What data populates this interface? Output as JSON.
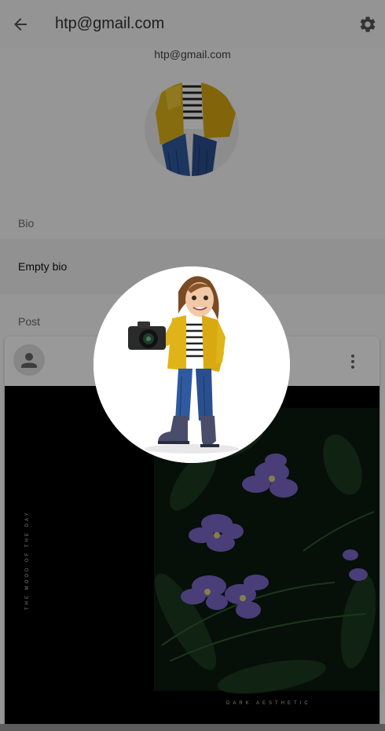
{
  "appbar": {
    "title": "htp@gmail.com",
    "back_icon": "arrow-back-icon",
    "settings_icon": "gear-icon"
  },
  "profile": {
    "email": "htp@gmail.com",
    "avatar": "cartoon-photographer-avatar"
  },
  "bio": {
    "label": "Bio",
    "text": "Empty bio"
  },
  "posts": {
    "label": "Post",
    "card": {
      "author_icon": "person-icon",
      "menu_icon": "more-vert-icon",
      "image_side_text": "THE MOOD OF THE DAY",
      "image_bottom_text": "DARK AESTHETIC"
    }
  },
  "overlay": {
    "avatar": "cartoon-photographer-avatar-enlarged",
    "scrim_opacity": 0.4
  },
  "colors": {
    "scrim": "#000000",
    "jacket": "#e0b419",
    "jeans": "#2f5aa0",
    "flower": "#7b68c8",
    "leaf": "#1c3a1f"
  }
}
